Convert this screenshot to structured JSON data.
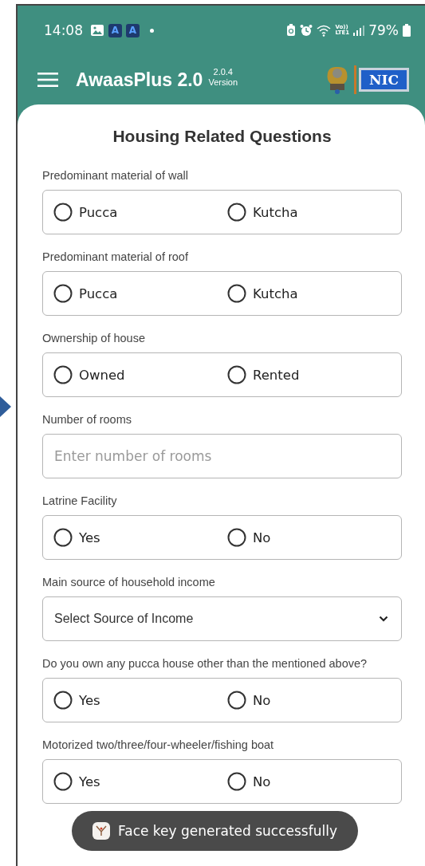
{
  "status_bar": {
    "time": "14:08",
    "app_badges": [
      "A",
      "A"
    ],
    "network_label": [
      "Vo))",
      "LTE1"
    ],
    "battery": "79%"
  },
  "header": {
    "title": "AwaasPlus 2.0",
    "version_number": "2.0.4",
    "version_label": "Version",
    "logo_text": "NIC"
  },
  "form": {
    "title": "Housing Related Questions",
    "questions": [
      {
        "kind": "radio",
        "label": "Predominant material of wall",
        "options": [
          {
            "label": "Pucca",
            "selected": false
          },
          {
            "label": "Kutcha",
            "selected": false
          }
        ]
      },
      {
        "kind": "radio",
        "label": "Predominant material of roof",
        "options": [
          {
            "label": "Pucca",
            "selected": false
          },
          {
            "label": "Kutcha",
            "selected": false
          }
        ]
      },
      {
        "kind": "radio",
        "label": "Ownership of house",
        "options": [
          {
            "label": "Owned",
            "selected": false
          },
          {
            "label": "Rented",
            "selected": false
          }
        ]
      },
      {
        "kind": "input",
        "label": "Number of rooms",
        "placeholder": "Enter number of rooms"
      },
      {
        "kind": "radio",
        "label": "Latrine Facility",
        "options": [
          {
            "label": "Yes",
            "selected": false
          },
          {
            "label": "No",
            "selected": false
          }
        ]
      },
      {
        "kind": "select",
        "label": "Main source of household income",
        "placeholder": "Select Source of Income"
      },
      {
        "kind": "radio",
        "label": "Do you own any pucca house other than the mentioned above?",
        "options": [
          {
            "label": "Yes",
            "selected": false
          },
          {
            "label": "No",
            "selected": false
          }
        ]
      },
      {
        "kind": "radio",
        "label": "Motorized two/three/four-wheeler/fishing boat",
        "options": [
          {
            "label": "Yes",
            "selected": false
          },
          {
            "label": "No",
            "selected": false
          }
        ]
      }
    ]
  },
  "toast": {
    "message": "Face key generated successfully"
  }
}
